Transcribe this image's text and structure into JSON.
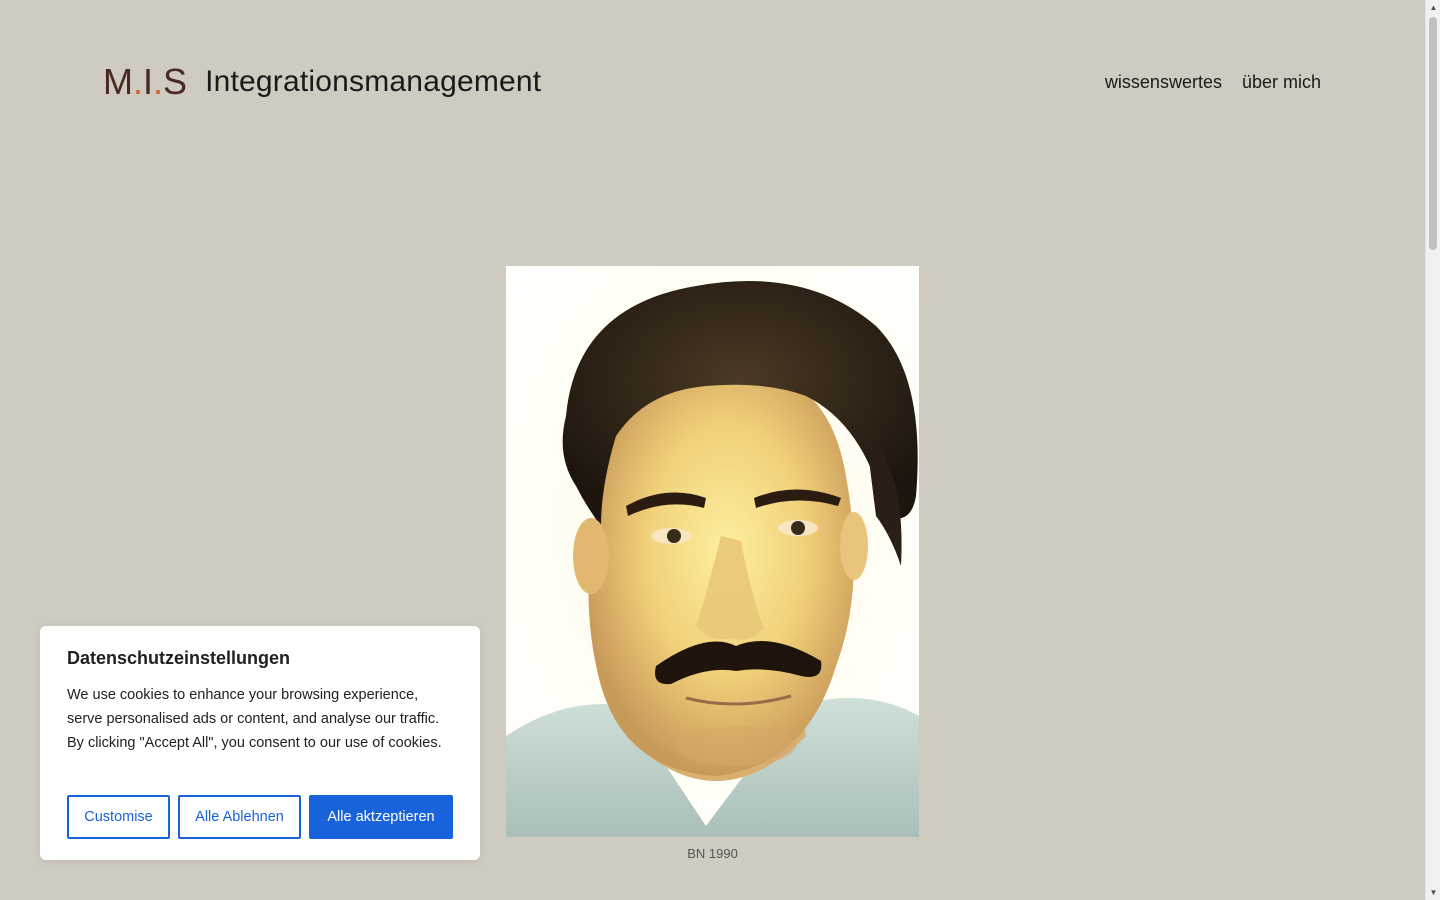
{
  "header": {
    "logo": {
      "m": "M",
      "dot1": ".",
      "i": "I",
      "dot2": ".",
      "s": "S"
    },
    "title": "Integrationsmanagement",
    "nav": [
      {
        "label": "wissenswertes"
      },
      {
        "label": "über mich"
      }
    ]
  },
  "figure": {
    "caption": "BN 1990",
    "image": "portrait-photo"
  },
  "cookie_banner": {
    "title": "Datenschutzeinstellungen",
    "text": "We use cookies to enhance your browsing experience, serve personalised ads or content, and analyse our traffic. By clicking \"Accept All\", you consent to our use of cookies.",
    "buttons": {
      "customise": "Customise",
      "reject": "Alle Ablehnen",
      "accept": "Alle aktzeptieren"
    }
  },
  "colors": {
    "background": "#cfcbc0",
    "logo_brown": "#4a2a20",
    "logo_accent": "#d4622a",
    "button_blue": "#1863dc"
  },
  "icons": {
    "scroll_up": "triangle-up-icon",
    "scroll_down": "triangle-down-icon"
  }
}
